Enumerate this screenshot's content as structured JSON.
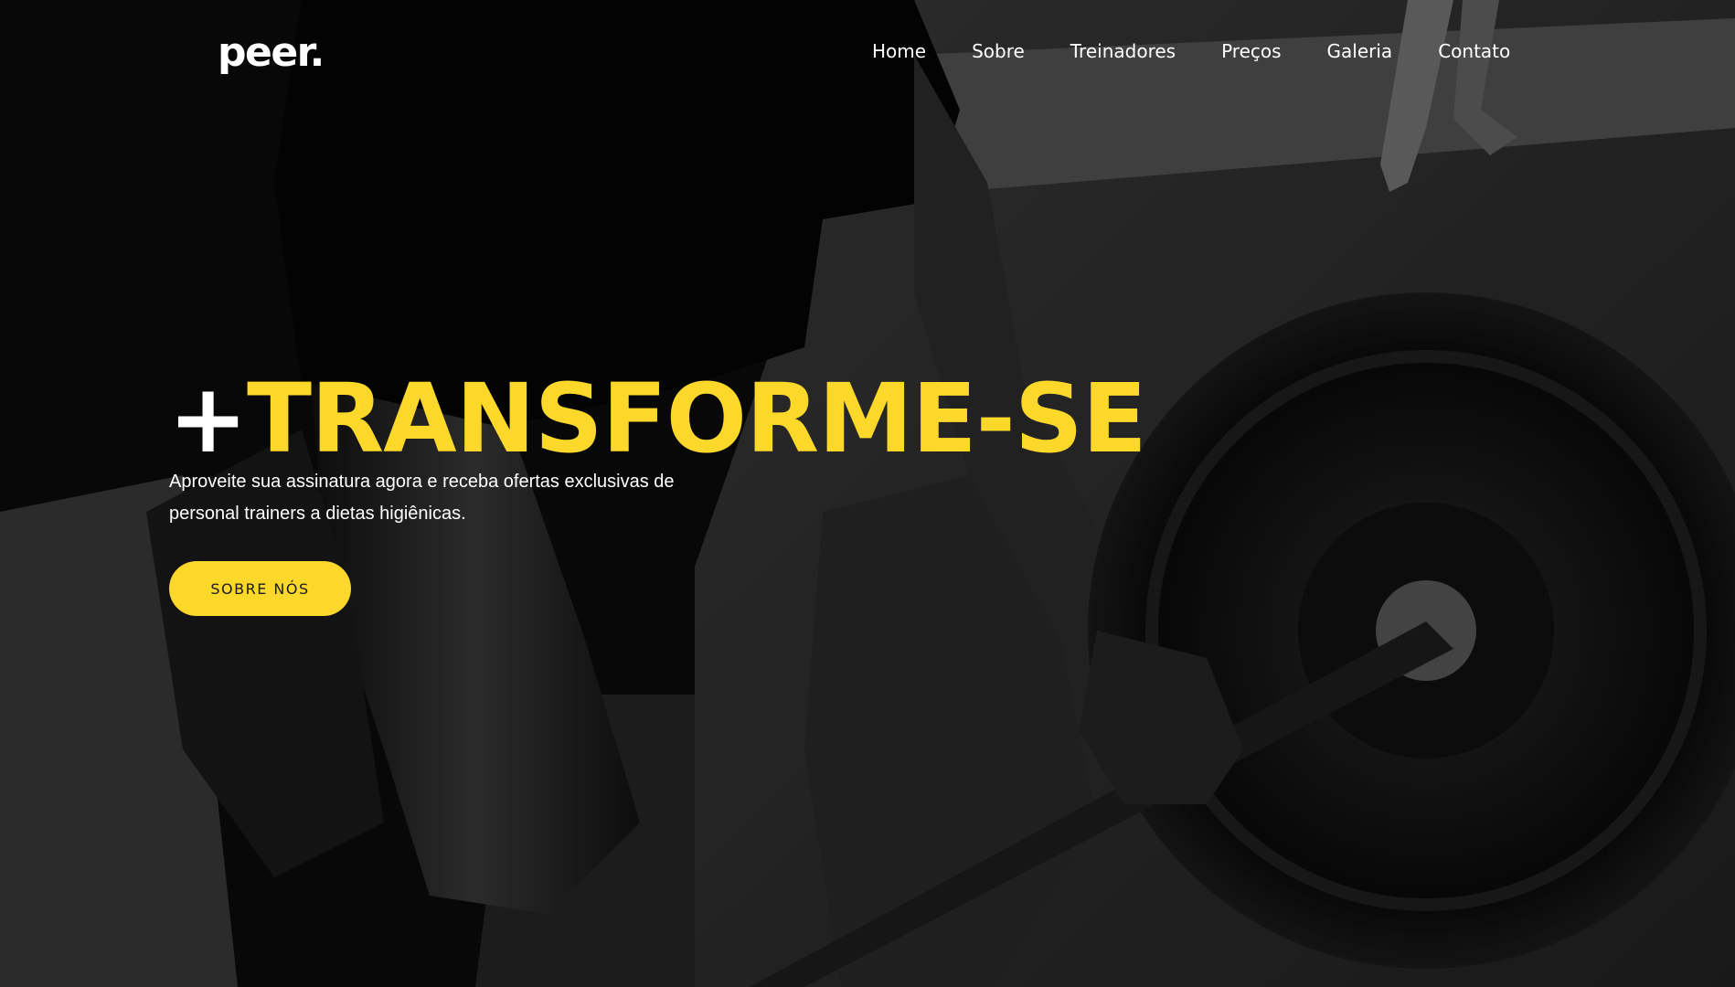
{
  "brand": {
    "logo": "peer."
  },
  "nav": {
    "items": [
      {
        "label": "Home"
      },
      {
        "label": "Sobre"
      },
      {
        "label": "Treinadores"
      },
      {
        "label": "Preços"
      },
      {
        "label": "Galeria"
      },
      {
        "label": "Contato"
      }
    ]
  },
  "hero": {
    "title_plus": "+",
    "title_word": "TRANSFORME-SE",
    "subtitle": "Aproveite sua assinatura agora e receba ofertas exclusivas de personal trainers a dietas higiênicas.",
    "cta_label": "SOBRE NÓS"
  },
  "colors": {
    "accent": "#fcd82b",
    "background": "#000000",
    "text": "#ffffff"
  }
}
